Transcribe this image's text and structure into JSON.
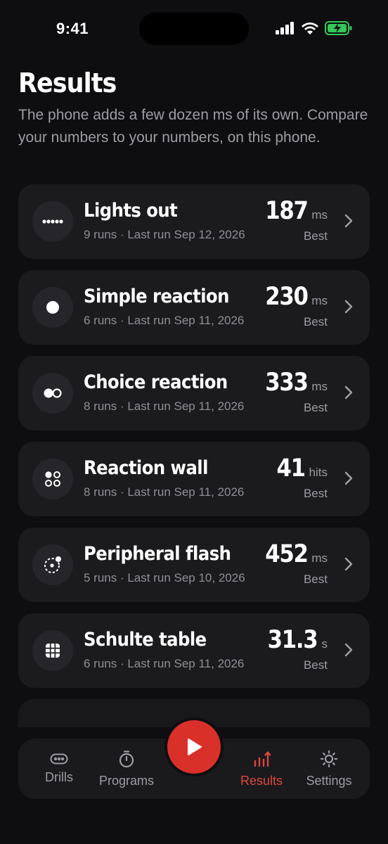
{
  "status_bar": {
    "time": "9:41"
  },
  "header": {
    "title": "Results",
    "subtitle": "The phone adds a few dozen ms of its own. Compare your numbers to your numbers, on this phone."
  },
  "drills": [
    {
      "icon": "dots-row-icon",
      "name": "Lights out",
      "meta": "9 runs · Last run Sep 12, 2026",
      "value": "187",
      "unit": "ms",
      "best_label": "Best"
    },
    {
      "icon": "single-dot-icon",
      "name": "Simple reaction",
      "meta": "6 runs · Last run Sep 11, 2026",
      "value": "230",
      "unit": "ms",
      "best_label": "Best"
    },
    {
      "icon": "two-dots-icon",
      "name": "Choice reaction",
      "meta": "8 runs · Last run Sep 11, 2026",
      "value": "333",
      "unit": "ms",
      "best_label": "Best"
    },
    {
      "icon": "four-dots-icon",
      "name": "Reaction wall",
      "meta": "8 runs · Last run Sep 11, 2026",
      "value": "41",
      "unit": "hits",
      "best_label": "Best"
    },
    {
      "icon": "peripheral-ring-icon",
      "name": "Peripheral flash",
      "meta": "5 runs · Last run Sep 10, 2026",
      "value": "452",
      "unit": "ms",
      "best_label": "Best"
    },
    {
      "icon": "grid-icon",
      "name": "Schulte table",
      "meta": "6 runs · Last run Sep 11, 2026",
      "value": "31.3",
      "unit": "s",
      "best_label": "Best"
    }
  ],
  "tab_bar": {
    "tabs": [
      {
        "label": "Drills",
        "icon": "drills-icon",
        "active": false
      },
      {
        "label": "Programs",
        "icon": "stopwatch-icon",
        "active": false
      },
      {
        "label": "Results",
        "icon": "results-chart-icon",
        "active": true
      },
      {
        "label": "Settings",
        "icon": "settings-sun-icon",
        "active": false
      }
    ],
    "play_icon": "play-icon"
  },
  "colors": {
    "background": "#0e0e10",
    "card": "#1b1b1e",
    "accent": "#d9302a",
    "active_tab": "#e0463d",
    "battery": "#34c759"
  }
}
